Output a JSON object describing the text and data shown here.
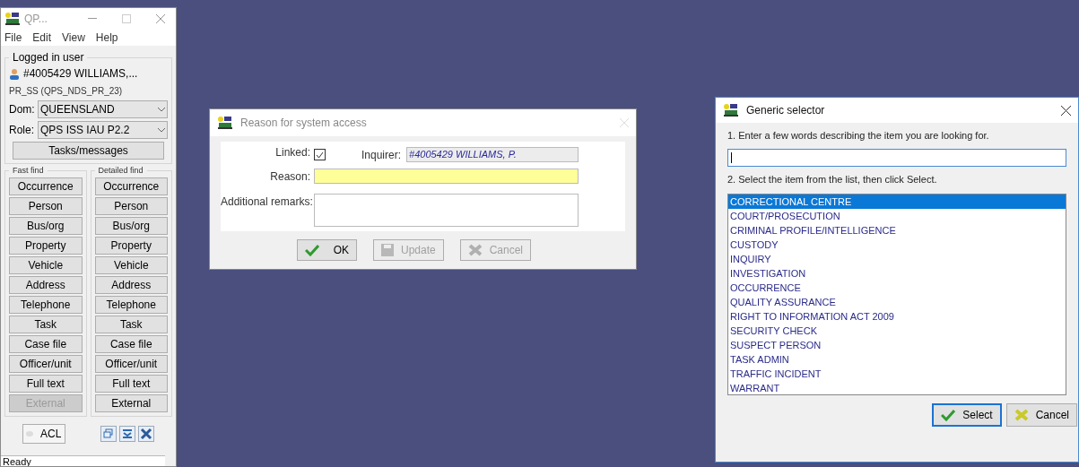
{
  "main_window": {
    "title": "QP...",
    "menu": [
      "File",
      "Edit",
      "View",
      "Help"
    ],
    "logged_in": {
      "legend": "Logged in user",
      "user": "#4005429 WILLIAMS,...",
      "profile": "PR_SS (QPS_NDS_PR_23)",
      "dom_label": "Dom:",
      "dom_value": "QUEENSLAND",
      "role_label": "Role:",
      "role_value": "QPS ISS IAU P2.2",
      "tasks_button": "Tasks/messages"
    },
    "fast_find": {
      "legend": "Fast find",
      "buttons": [
        {
          "label": "Occurrence",
          "disabled": false
        },
        {
          "label": "Person",
          "disabled": false
        },
        {
          "label": "Bus/org",
          "disabled": false
        },
        {
          "label": "Property",
          "disabled": false
        },
        {
          "label": "Vehicle",
          "disabled": false
        },
        {
          "label": "Address",
          "disabled": false
        },
        {
          "label": "Telephone",
          "disabled": false
        },
        {
          "label": "Task",
          "disabled": false
        },
        {
          "label": "Case file",
          "disabled": false
        },
        {
          "label": "Officer/unit",
          "disabled": false
        },
        {
          "label": "Full text",
          "disabled": false
        },
        {
          "label": "External",
          "disabled": true
        }
      ]
    },
    "detailed_find": {
      "legend": "Detailed find",
      "buttons": [
        {
          "label": "Occurrence",
          "disabled": false
        },
        {
          "label": "Person",
          "disabled": false
        },
        {
          "label": "Bus/org",
          "disabled": false
        },
        {
          "label": "Property",
          "disabled": false
        },
        {
          "label": "Vehicle",
          "disabled": false
        },
        {
          "label": "Address",
          "disabled": false
        },
        {
          "label": "Telephone",
          "disabled": false
        },
        {
          "label": "Task",
          "disabled": false
        },
        {
          "label": "Case file",
          "disabled": false
        },
        {
          "label": "Officer/unit",
          "disabled": false
        },
        {
          "label": "Full text",
          "disabled": false
        },
        {
          "label": "External",
          "disabled": false
        }
      ]
    },
    "acl_button": "ACL",
    "status_bar": "Ready"
  },
  "reason_dialog": {
    "title": "Reason for system access",
    "linked_label": "Linked:",
    "linked_checked": true,
    "inquirer_label": "Inquirer:",
    "inquirer_value": "#4005429 WILLIAMS, P.",
    "reason_label": "Reason:",
    "remarks_label": "Additional remarks:",
    "buttons": [
      {
        "label": "OK",
        "kind": "ok",
        "disabled": false
      },
      {
        "label": "Update",
        "kind": "save",
        "disabled": true
      },
      {
        "label": "Cancel",
        "kind": "cancel",
        "disabled": true
      }
    ]
  },
  "selector_dialog": {
    "title": "Generic selector",
    "step_1": "1. Enter a few words describing the item you are looking for.",
    "step_2": "2. Select the item from the list, then click Select.",
    "items": [
      {
        "label": "CORRECTIONAL CENTRE",
        "selected": true
      },
      {
        "label": "COURT/PROSECUTION",
        "selected": false
      },
      {
        "label": "CRIMINAL PROFILE/INTELLIGENCE",
        "selected": false
      },
      {
        "label": "CUSTODY",
        "selected": false
      },
      {
        "label": "INQUIRY",
        "selected": false
      },
      {
        "label": "INVESTIGATION",
        "selected": false
      },
      {
        "label": "OCCURRENCE",
        "selected": false
      },
      {
        "label": "QUALITY ASSURANCE",
        "selected": false
      },
      {
        "label": "RIGHT TO INFORMATION ACT 2009",
        "selected": false
      },
      {
        "label": "SECURITY CHECK",
        "selected": false
      },
      {
        "label": "SUSPECT PERSON",
        "selected": false
      },
      {
        "label": "TASK ADMIN",
        "selected": false
      },
      {
        "label": "TRAFFIC INCIDENT",
        "selected": false
      },
      {
        "label": "WARRANT",
        "selected": false
      }
    ],
    "buttons": [
      {
        "label": "Select",
        "kind": "ok",
        "disabled": false
      },
      {
        "label": "Cancel",
        "kind": "cancel",
        "disabled": false
      }
    ]
  }
}
